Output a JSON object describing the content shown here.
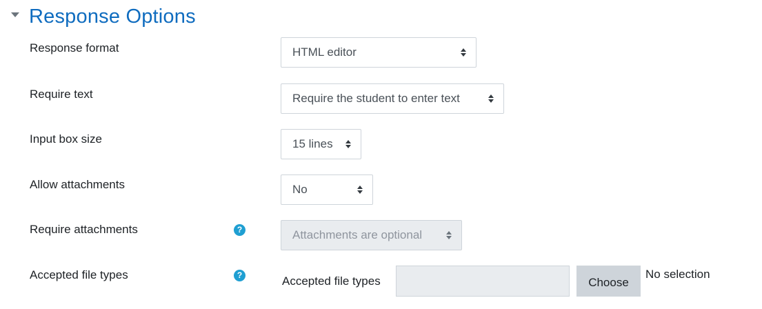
{
  "section": {
    "title": "Response Options"
  },
  "fields": {
    "response_format": {
      "label": "Response format",
      "value": "HTML editor"
    },
    "require_text": {
      "label": "Require text",
      "value": "Require the student to enter text"
    },
    "input_box_size": {
      "label": "Input box size",
      "value": "15 lines"
    },
    "allow_attachments": {
      "label": "Allow attachments",
      "value": "No"
    },
    "require_attachments": {
      "label": "Require attachments",
      "value": "Attachments are optional",
      "help_icon": "question-circle-icon",
      "disabled": true
    },
    "accepted_file_types": {
      "label": "Accepted file types",
      "help_icon": "question-circle-icon",
      "picker_label": "Accepted file types",
      "button_label": "Choose",
      "selection_text": "No selection"
    }
  },
  "colors": {
    "accent": "#0f6cbf",
    "help_icon": "#1f9fd2",
    "text": "#1d2125",
    "disabled_bg": "#e9ecef"
  }
}
